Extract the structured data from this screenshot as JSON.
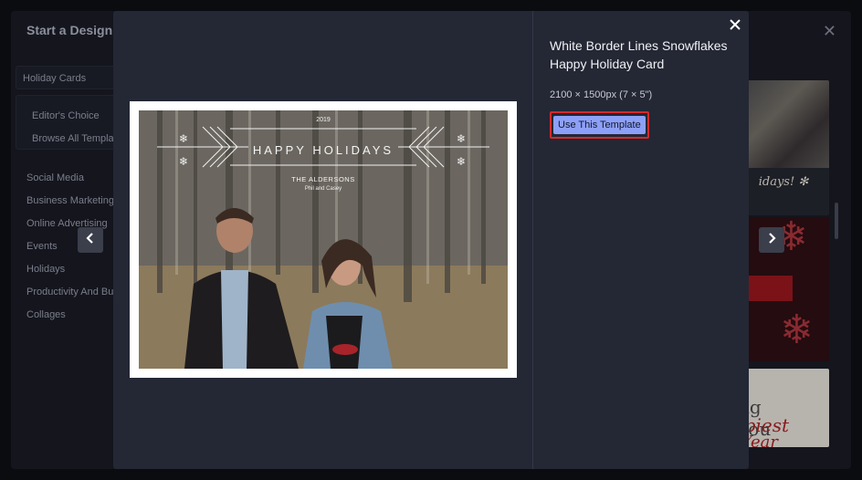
{
  "background": {
    "title": "Start a Design",
    "menu_boxed": [
      "Holiday Cards"
    ],
    "menu_group": [
      "Editor's Choice",
      "Browse All Templates"
    ],
    "categories": [
      "Social Media",
      "Business Marketing",
      "Online Advertising",
      "Events",
      "Holidays",
      "Productivity And Business",
      "Collages"
    ],
    "thumb_caption": "idays!",
    "thumb3_lines": [
      "ng you",
      "ppiest",
      "Year"
    ]
  },
  "modal": {
    "template_title": "White Border Lines Snowflakes Happy Holiday Card",
    "dimensions": "2100 × 1500px (7 × 5\")",
    "use_button": "Use This Template",
    "icons": {
      "close": "close-icon",
      "prev": "chevron-left-icon",
      "next": "chevron-right-icon"
    }
  },
  "card": {
    "year": "2019",
    "greeting": "HAPPY HOLIDAYS",
    "family": "THE ALDERSONS",
    "names": "Phil and Casey"
  },
  "colors": {
    "accent_button": "#8da0f8",
    "highlight_border": "#d42a2a",
    "modal_bg": "#242734"
  }
}
